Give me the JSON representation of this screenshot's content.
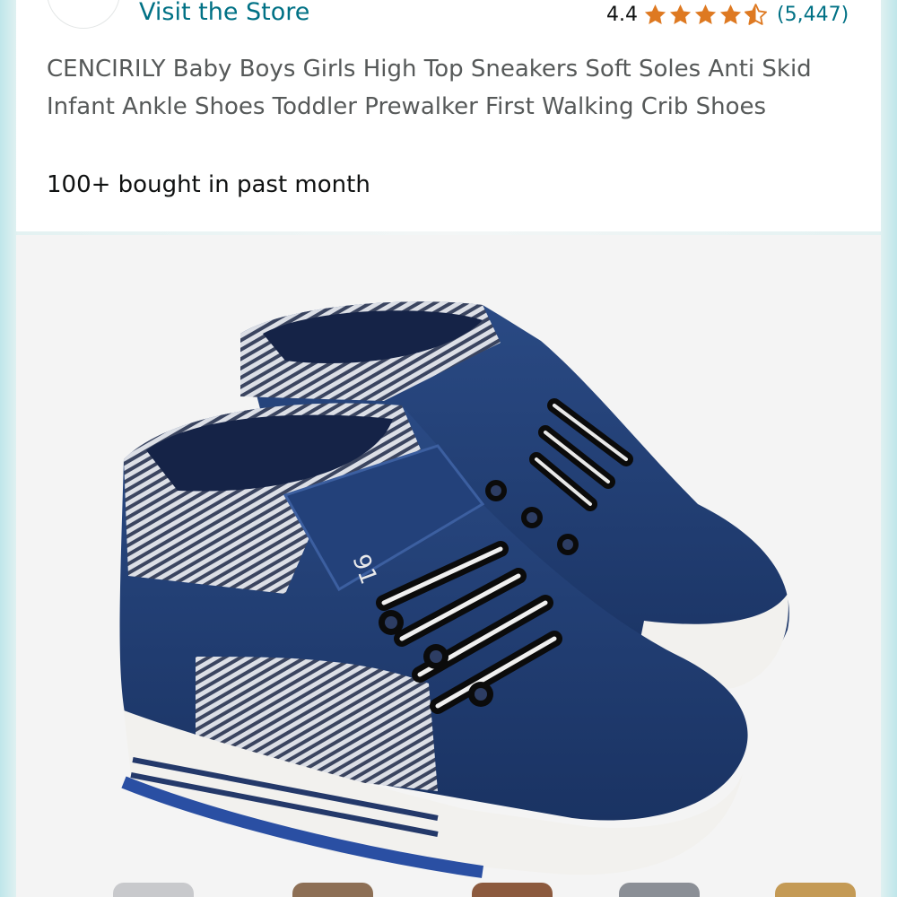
{
  "store": {
    "link_label": "Visit the Store"
  },
  "rating": {
    "value": "4.4",
    "stars": 4.4,
    "review_count": "(5,447)"
  },
  "product": {
    "title": "CENCIRILY Baby Boys Girls High Top Sneakers Soft Soles Anti Skid Infant Ankle Shoes Toddler Prewalker First Walking Crib Shoes",
    "bought_text": "100+ bought in past month",
    "image_tag_text": "91"
  },
  "colors": {
    "link": "#007185",
    "star": "#de7921",
    "shoe_navy": "#1f3a6b"
  },
  "icons": {
    "star": "star-icon",
    "half_star": "half-star-icon"
  }
}
